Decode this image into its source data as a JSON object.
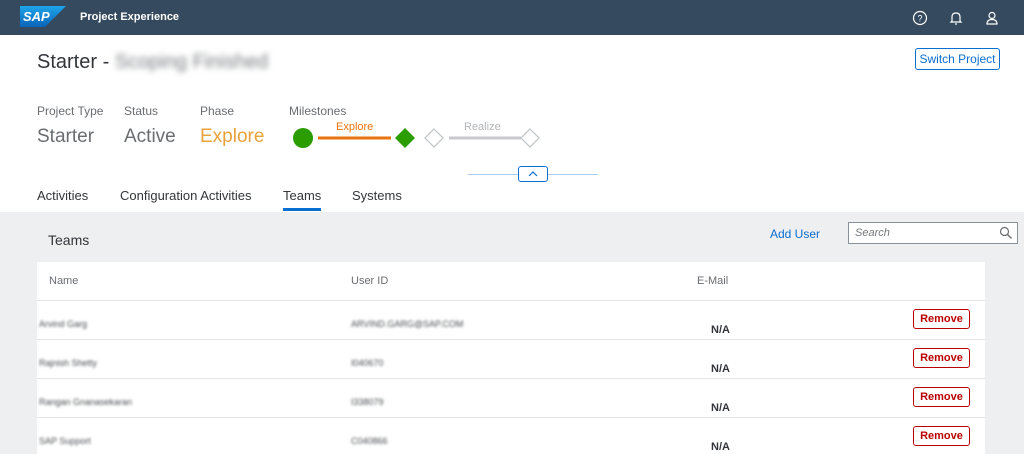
{
  "shell": {
    "logo_text": "SAP",
    "title": "Project Experience",
    "icons": [
      "help-icon",
      "notification-bell-icon",
      "user-icon"
    ]
  },
  "header": {
    "title_prefix": "Starter - ",
    "title_blurred": "Scoping Finished",
    "switch_project_label": "Switch Project"
  },
  "project_meta": {
    "type_label": "Project Type",
    "type_value": "Starter",
    "status_label": "Status",
    "status_value": "Active",
    "phase_label": "Phase",
    "phase_value": "Explore",
    "milestones_label": "Milestones"
  },
  "milestones": [
    {
      "label": "Explore",
      "state": "active"
    },
    {
      "label": "Realize",
      "state": "upcoming"
    }
  ],
  "tabs": [
    {
      "label": "Activities",
      "selected": false
    },
    {
      "label": "Configuration Activities",
      "selected": false
    },
    {
      "label": "Teams",
      "selected": true
    },
    {
      "label": "Systems",
      "selected": false
    }
  ],
  "teams": {
    "title": "Teams",
    "add_user_label": "Add User",
    "search_placeholder": "Search",
    "columns": [
      "Name",
      "User ID",
      "E-Mail"
    ],
    "remove_label": "Remove",
    "rows": [
      {
        "name": "Arvind Garg",
        "user_id": "ARVIND.GARG@SAP.COM",
        "email": "N/A"
      },
      {
        "name": "Rajnish Shetty",
        "user_id": "I040670",
        "email": "N/A"
      },
      {
        "name": "Rangan Gnanasekaran",
        "user_id": "I338079",
        "email": "N/A"
      },
      {
        "name": "SAP Support",
        "user_id": "C040866",
        "email": "N/A"
      }
    ]
  },
  "colors": {
    "shell_bg": "#354a5f",
    "accent_blue": "#0a6ed1",
    "phase_orange": "#e9a23b",
    "milestone_green": "#2b9d00",
    "milestone_line": "#e9730c",
    "remove_red": "#bb0000"
  }
}
